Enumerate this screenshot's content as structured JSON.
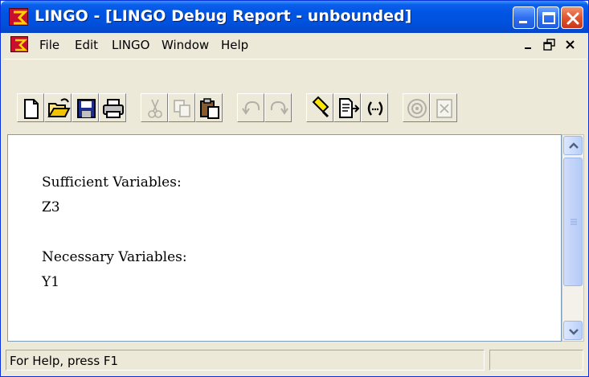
{
  "window": {
    "title": "LINGO - [LINGO Debug Report - unbounded]",
    "accent_color": "#0054E3",
    "close_color": "#E0552F"
  },
  "menu": {
    "items": [
      "File",
      "Edit",
      "LINGO",
      "Window",
      "Help"
    ]
  },
  "toolbar": {
    "buttons": [
      {
        "icon": "new-file-icon",
        "enabled": true
      },
      {
        "icon": "open-folder-icon",
        "enabled": true
      },
      {
        "icon": "save-icon",
        "enabled": true
      },
      {
        "icon": "print-icon",
        "enabled": true
      },
      {
        "icon": "cut-icon",
        "enabled": false
      },
      {
        "icon": "copy-icon",
        "enabled": false
      },
      {
        "icon": "paste-icon",
        "enabled": true
      },
      {
        "icon": "undo-icon",
        "enabled": false
      },
      {
        "icon": "redo-icon",
        "enabled": false
      },
      {
        "icon": "find-icon",
        "enabled": true
      },
      {
        "icon": "go-to-line-icon",
        "enabled": true
      },
      {
        "icon": "match-parenthesis-icon",
        "enabled": true
      },
      {
        "icon": "solve-icon",
        "enabled": false
      },
      {
        "icon": "solution-icon",
        "enabled": false
      }
    ]
  },
  "report": {
    "sufficient_heading": "Sufficient Variables:",
    "sufficient_value": "Z3",
    "necessary_heading": "Necessary Variables:",
    "necessary_value": "Y1"
  },
  "status": {
    "help_text": "For Help, press F1"
  }
}
